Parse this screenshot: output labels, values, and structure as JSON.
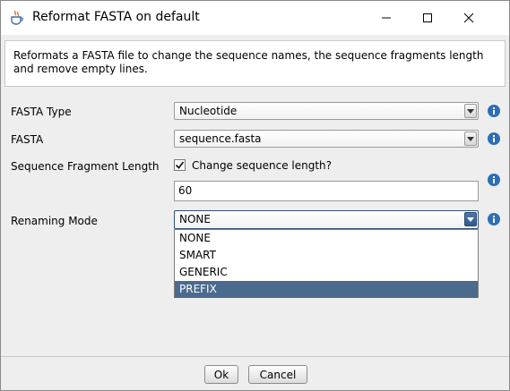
{
  "window": {
    "title": "Reformat FASTA on default",
    "icon": "java-cup-icon",
    "controls": [
      "minimize-icon",
      "maximize-icon",
      "close-icon"
    ]
  },
  "description": "Reformats a FASTA file to change the sequence names, the sequence fragments length and remove empty lines.",
  "form": {
    "fasta_type": {
      "label": "FASTA Type",
      "value": "Nucleotide"
    },
    "fasta": {
      "label": "FASTA",
      "value": "sequence.fasta"
    },
    "fragment_length": {
      "label": "Sequence Fragment Length",
      "checkbox_label": "Change sequence length?",
      "checked": true,
      "value": "60"
    },
    "renaming_mode": {
      "label": "Renaming Mode",
      "value": "NONE",
      "options": [
        "NONE",
        "SMART",
        "GENERIC",
        "PREFIX"
      ],
      "highlighted": "PREFIX"
    }
  },
  "buttons": {
    "ok": "Ok",
    "cancel": "Cancel"
  },
  "colors": {
    "selection": "#4a6b8d",
    "info_icon": "#2c6fb5",
    "active_arrow": "#2f5a8c"
  }
}
